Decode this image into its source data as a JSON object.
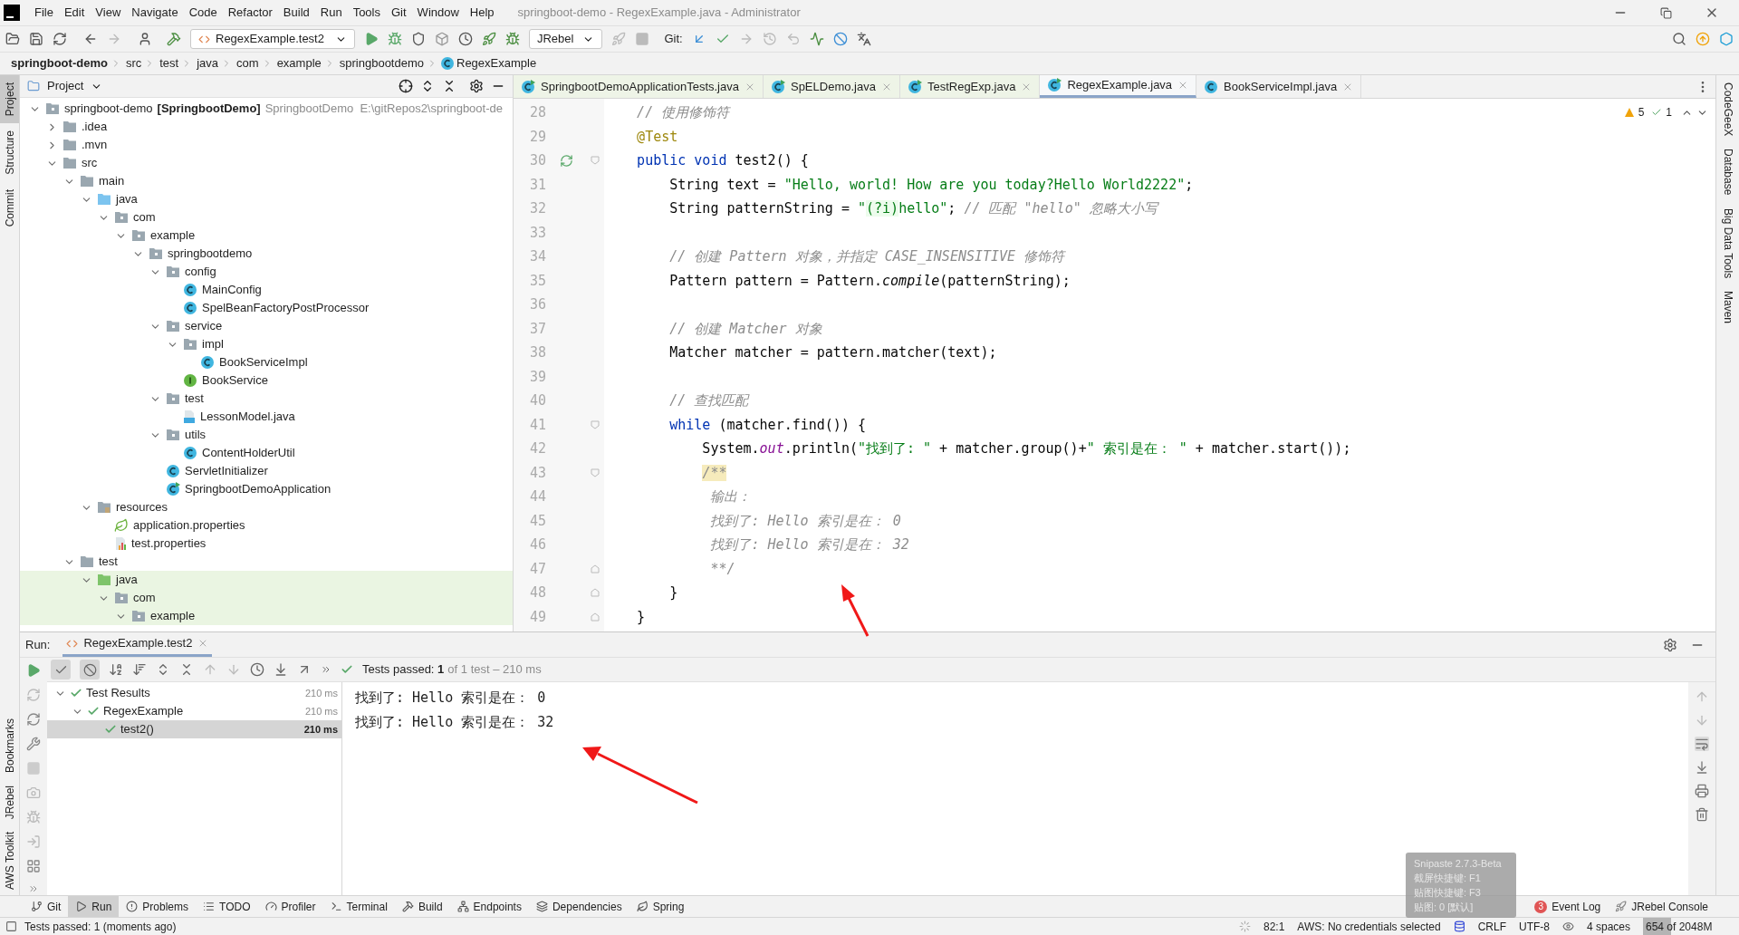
{
  "window": {
    "title": "springboot-demo - RegexExample.java - Administrator"
  },
  "menu": [
    "File",
    "Edit",
    "View",
    "Navigate",
    "Code",
    "Refactor",
    "Build",
    "Run",
    "Tools",
    "Git",
    "Window",
    "Help"
  ],
  "toolbar": {
    "run_config": "RegexExample.test2",
    "jrebel": "JRebel",
    "git_label": "Git:"
  },
  "breadcrumbs": [
    "springboot-demo",
    "src",
    "test",
    "java",
    "com",
    "example",
    "springbootdemo",
    "RegexExample"
  ],
  "left_tool_windows": [
    {
      "label": "Project",
      "selected": true
    },
    {
      "label": "Structure",
      "selected": false
    },
    {
      "label": "Commit",
      "selected": false
    }
  ],
  "left_tool_windows_bottom": [
    "Bookmarks",
    "JRebel",
    "AWS Toolkit"
  ],
  "right_tool_windows": [
    "CodeGeeX",
    "Database",
    "Big Data Tools",
    "Maven"
  ],
  "project": {
    "title": "Project",
    "tree": [
      {
        "name": "springboot-demo",
        "module": "[SpringbootDemo]",
        "hint": "SpringbootDemo  E:\\gitRepos2\\springboot-de",
        "kind": "module",
        "expanded": true,
        "highlighted": false,
        "children": [
          {
            "name": ".idea",
            "kind": "folder",
            "expanded": false,
            "highlighted": false
          },
          {
            "name": ".mvn",
            "kind": "folder",
            "expanded": false,
            "highlighted": false
          },
          {
            "name": "src",
            "kind": "folder",
            "expanded": true,
            "highlighted": false,
            "children": [
              {
                "name": "main",
                "kind": "folder",
                "expanded": true,
                "highlighted": false,
                "children": [
                  {
                    "name": "java",
                    "kind": "source_folder",
                    "expanded": true,
                    "highlighted": false,
                    "children": [
                      {
                        "name": "com",
                        "kind": "package",
                        "expanded": true,
                        "highlighted": false,
                        "children": [
                          {
                            "name": "example",
                            "kind": "package",
                            "expanded": true,
                            "highlighted": false,
                            "children": [
                              {
                                "name": "springbootdemo",
                                "kind": "package",
                                "expanded": true,
                                "highlighted": false,
                                "children": [
                                  {
                                    "name": "config",
                                    "kind": "package",
                                    "expanded": true,
                                    "highlighted": false,
                                    "children": [
                                      {
                                        "name": "MainConfig",
                                        "kind": "class",
                                        "highlighted": false
                                      },
                                      {
                                        "name": "SpelBeanFactoryPostProcessor",
                                        "kind": "class",
                                        "highlighted": false
                                      }
                                    ]
                                  },
                                  {
                                    "name": "service",
                                    "kind": "package",
                                    "expanded": true,
                                    "highlighted": false,
                                    "children": [
                                      {
                                        "name": "impl",
                                        "kind": "package",
                                        "expanded": true,
                                        "highlighted": false,
                                        "children": [
                                          {
                                            "name": "BookServiceImpl",
                                            "kind": "class",
                                            "highlighted": false
                                          }
                                        ]
                                      },
                                      {
                                        "name": "BookService",
                                        "kind": "interface",
                                        "highlighted": false
                                      }
                                    ]
                                  },
                                  {
                                    "name": "test",
                                    "kind": "package",
                                    "expanded": true,
                                    "highlighted": false,
                                    "children": [
                                      {
                                        "name": "LessonModel.java",
                                        "kind": "java_file",
                                        "highlighted": false
                                      }
                                    ]
                                  },
                                  {
                                    "name": "utils",
                                    "kind": "package",
                                    "expanded": true,
                                    "highlighted": false,
                                    "children": [
                                      {
                                        "name": "ContentHolderUtil",
                                        "kind": "class",
                                        "highlighted": false
                                      }
                                    ]
                                  },
                                  {
                                    "name": "ServletInitializer",
                                    "kind": "class",
                                    "highlighted": false
                                  },
                                  {
                                    "name": "SpringbootDemoApplication",
                                    "kind": "app_class",
                                    "highlighted": false
                                  }
                                ]
                              }
                            ]
                          }
                        ]
                      }
                    ]
                  },
                  {
                    "name": "resources",
                    "kind": "resources_folder",
                    "expanded": true,
                    "highlighted": false,
                    "children": [
                      {
                        "name": "application.properties",
                        "kind": "spring_properties",
                        "highlighted": false
                      },
                      {
                        "name": "test.properties",
                        "kind": "properties",
                        "highlighted": false
                      }
                    ]
                  }
                ]
              },
              {
                "name": "test",
                "kind": "folder",
                "expanded": true,
                "highlighted": false,
                "children": [
                  {
                    "name": "java",
                    "kind": "test_folder",
                    "expanded": true,
                    "highlighted": true,
                    "children": [
                      {
                        "name": "com",
                        "kind": "package",
                        "expanded": true,
                        "highlighted": true,
                        "children": [
                          {
                            "name": "example",
                            "kind": "package",
                            "expanded": true,
                            "highlighted": true
                          }
                        ]
                      }
                    ]
                  }
                ]
              }
            ]
          }
        ]
      }
    ]
  },
  "editor": {
    "tabs": [
      {
        "label": "SpringbootDemoApplicationTests.java",
        "selected": false,
        "test_scope": true
      },
      {
        "label": "SpELDemo.java",
        "selected": false,
        "test_scope": true
      },
      {
        "label": "TestRegExp.java",
        "selected": false,
        "test_scope": true
      },
      {
        "label": "RegexExample.java",
        "selected": true,
        "test_scope": true
      },
      {
        "label": "BookServiceImpl.java",
        "selected": false,
        "test_scope": false
      }
    ],
    "inspections": {
      "warnings": "5",
      "weak_warnings": "1"
    },
    "lines": [
      {
        "number": "28",
        "tokens": [
          {
            "kind": "comment",
            "text": "    // 使用修饰符"
          }
        ]
      },
      {
        "number": "29",
        "tokens": [
          {
            "kind": "annotation",
            "text": "    @Test"
          }
        ]
      },
      {
        "number": "30",
        "run_marker": true,
        "fold_start": true,
        "tokens": [
          {
            "kind": "keyword",
            "text": "    public void"
          },
          {
            "kind": "plain",
            "text": " test2() {"
          }
        ]
      },
      {
        "number": "31",
        "tokens": [
          {
            "kind": "plain",
            "text": "        String text = "
          },
          {
            "kind": "string",
            "text": "\"Hello, world! How are you today?Hello World2222\""
          },
          {
            "kind": "plain",
            "text": ";"
          }
        ]
      },
      {
        "number": "32",
        "tokens": [
          {
            "kind": "plain",
            "text": "        String patternString = "
          },
          {
            "kind": "string",
            "text": "\""
          },
          {
            "kind": "regex",
            "text": "(?i)"
          },
          {
            "kind": "string",
            "text": "hello\""
          },
          {
            "kind": "plain",
            "text": "; "
          },
          {
            "kind": "comment",
            "text": "// 匹配 \"hello\" 忽略大小写"
          }
        ]
      },
      {
        "number": "33"
      },
      {
        "number": "34",
        "tokens": [
          {
            "kind": "comment",
            "text": "        // 创建 Pattern 对象，并指定 CASE_INSENSITIVE 修饰符"
          }
        ]
      },
      {
        "number": "35",
        "tokens": [
          {
            "kind": "plain",
            "text": "        Pattern pattern = Pattern."
          },
          {
            "kind": "italic",
            "text": "compile"
          },
          {
            "kind": "plain",
            "text": "(patternString);"
          }
        ]
      },
      {
        "number": "36"
      },
      {
        "number": "37",
        "tokens": [
          {
            "kind": "comment",
            "text": "        // 创建 Matcher 对象"
          }
        ]
      },
      {
        "number": "38",
        "tokens": [
          {
            "kind": "plain",
            "text": "        Matcher matcher = pattern.matcher(text);"
          }
        ]
      },
      {
        "number": "39"
      },
      {
        "number": "40",
        "tokens": [
          {
            "kind": "comment",
            "text": "        // 查找匹配"
          }
        ]
      },
      {
        "number": "41",
        "fold_start": true,
        "tokens": [
          {
            "kind": "keyword",
            "text": "        while"
          },
          {
            "kind": "plain",
            "text": " (matcher.find()) {"
          }
        ]
      },
      {
        "number": "42",
        "tokens": [
          {
            "kind": "plain",
            "text": "            System."
          },
          {
            "kind": "static",
            "text": "out"
          },
          {
            "kind": "plain",
            "text": ".println("
          },
          {
            "kind": "string",
            "text": "\"找到了: \""
          },
          {
            "kind": "plain",
            "text": " + matcher.group()+"
          },
          {
            "kind": "string",
            "text": "\" 索引是在： \""
          },
          {
            "kind": "plain",
            "text": " + matcher.start());"
          }
        ]
      },
      {
        "number": "43",
        "fold_start": true,
        "tokens": [
          {
            "kind": "doc_start",
            "text": "            /**"
          }
        ]
      },
      {
        "number": "44",
        "tokens": [
          {
            "kind": "doc",
            "text": "             输出："
          }
        ]
      },
      {
        "number": "45",
        "tokens": [
          {
            "kind": "doc",
            "text": "             找到了: Hello 索引是在： 0"
          }
        ]
      },
      {
        "number": "46",
        "tokens": [
          {
            "kind": "doc",
            "text": "             找到了: Hello 索引是在： 32"
          }
        ]
      },
      {
        "number": "47",
        "fold_end": true,
        "tokens": [
          {
            "kind": "doc",
            "text": "             **/"
          }
        ]
      },
      {
        "number": "48",
        "fold_end": true,
        "tokens": [
          {
            "kind": "plain",
            "text": "        }"
          }
        ]
      },
      {
        "number": "49",
        "fold_end": true,
        "tokens": [
          {
            "kind": "plain",
            "text": "    }"
          }
        ]
      }
    ]
  },
  "run": {
    "label": "Run:",
    "tab": "RegexExample.test2",
    "toggles": [
      {
        "kind": "passed",
        "selected": true
      },
      {
        "kind": "ignored",
        "selected": true
      }
    ],
    "status": "Tests passed: **1**",
    "status_detail": "of 1 test – 210 ms",
    "tests": [
      {
        "name": "Test Results",
        "time": "210 ms",
        "passed": true,
        "selected": false,
        "expanded": true,
        "children": [
          {
            "name": "RegexExample",
            "time": "210 ms",
            "passed": true,
            "selected": false,
            "expanded": true,
            "children": [
              {
                "name": "test2()",
                "time": "210 ms",
                "passed": true,
                "selected": true
              }
            ]
          }
        ]
      }
    ],
    "console": [
      "找到了: Hello 索引是在： 0",
      "找到了: Hello 索引是在： 32"
    ]
  },
  "tool_tabs": [
    {
      "label": "Git",
      "selected": false
    },
    {
      "label": "Run",
      "selected": true
    },
    {
      "label": "Problems",
      "selected": false
    },
    {
      "label": "TODO",
      "selected": false
    },
    {
      "label": "Profiler",
      "selected": false
    },
    {
      "label": "Terminal",
      "selected": false
    },
    {
      "label": "Build",
      "selected": false
    },
    {
      "label": "Endpoints",
      "selected": false
    },
    {
      "label": "Dependencies",
      "selected": false
    },
    {
      "label": "Spring",
      "selected": false
    }
  ],
  "tool_tabs_right": [
    {
      "label": "Event Log",
      "badge": "3"
    },
    {
      "label": "JRebel Console"
    }
  ],
  "status_bar": {
    "message": "Tests passed: 1 (moments ago)",
    "position": "82:1",
    "aws": "AWS: No credentials selected",
    "line_separator": "CRLF",
    "encoding": "UTF-8",
    "indent": "4 spaces",
    "memory": {
      "text": "654 of 2048M",
      "level": 0.32
    }
  },
  "tooltip": {
    "lines": [
      "Snipaste 2.7.3-Beta",
      "截屏快捷键: F1",
      "贴图快捷键: F3",
      "贴图: 0 [默认]"
    ]
  }
}
